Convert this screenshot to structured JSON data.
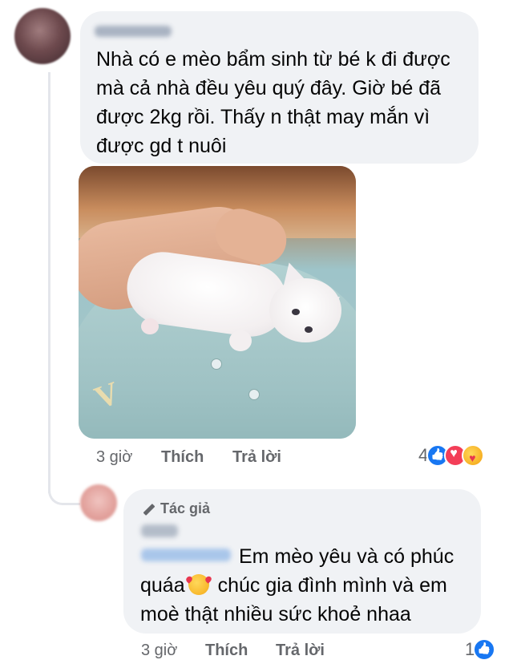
{
  "comment_1": {
    "author": "Hùng Anh",
    "text": "Nhà có e mèo bẩm sinh từ bé k đi được mà cả nhà đều yêu quý đây. Giờ bé đã được 2kg rồi. Thấy n thật may mắn vì được gd t nuôi",
    "photo_icon": "kitten-photo",
    "time": "3 giờ",
    "like_label": "Thích",
    "reply_label": "Trả lời",
    "reaction_count": "4",
    "reactions": [
      "like-icon",
      "love-icon",
      "care-icon"
    ]
  },
  "reply_1": {
    "badge": "Tác giả",
    "author": "Hùng",
    "mention": "Hùng Anh",
    "text_line1": "Em mèo yêu và có phúc",
    "text_line2a": "quáa",
    "emoji": "smiling-face-with-hearts",
    "text_line2b": "chúc gia đình mình và em",
    "text_line3": "moè thật nhiều sức khoẻ nhaa",
    "time": "3 giờ",
    "like_label": "Thích",
    "reply_label": "Trả lời",
    "reaction_count": "1",
    "reactions": [
      "like-icon"
    ]
  },
  "colors": {
    "bubble": "#f0f2f5",
    "meta": "#65676b",
    "like": "#1877f2",
    "love": "#f33e58"
  }
}
